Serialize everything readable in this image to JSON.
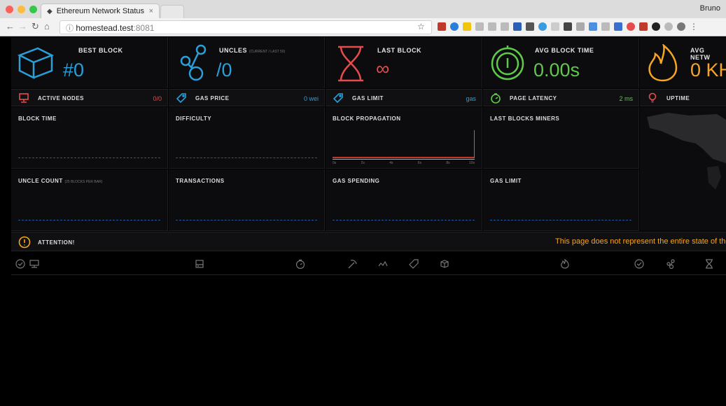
{
  "browser": {
    "tab_title": "Ethereum Network Status",
    "tab_close": "×",
    "profile": "Bruno",
    "url_host": "homestead.test",
    "url_port": ":8081",
    "traffic_colors": [
      "#fc605b",
      "#fdbc40",
      "#34c84a"
    ]
  },
  "top": {
    "best_block": {
      "label": "BEST BLOCK",
      "value": "#0",
      "color": "#2a9fd8"
    },
    "uncles": {
      "label": "UNCLES",
      "sub": "(CURRENT / LAST 50)",
      "value": "/0",
      "color": "#2a9fd8"
    },
    "last_block": {
      "label": "LAST BLOCK",
      "value": "∞",
      "color": "#e74c4c"
    },
    "avg_block_time": {
      "label": "AVG BLOCK TIME",
      "value": "0.00s",
      "color": "#5fc94b"
    },
    "avg_network": {
      "label": "AVG NETW",
      "value": "0 KH",
      "color": "#f5a623"
    }
  },
  "stats": {
    "active_nodes": {
      "label": "ACTIVE NODES",
      "value": "0/0",
      "color": "#e74c4c"
    },
    "gas_price": {
      "label": "GAS PRICE",
      "value": "0 wei",
      "color": "#2a9fd8"
    },
    "gas_limit": {
      "label": "GAS LIMIT",
      "value": "gas",
      "color": "#2a9fd8"
    },
    "page_latency": {
      "label": "PAGE LATENCY",
      "value": "2 ms",
      "color": "#5fc94b"
    },
    "uptime": {
      "label": "UPTIME",
      "color": "#e74c4c"
    }
  },
  "charts": {
    "block_time": "BLOCK TIME",
    "difficulty": "DIFFICULTY",
    "block_propagation": "BLOCK PROPAGATION",
    "last_blocks_miners": "LAST BLOCKS MINERS",
    "uncle_count": "UNCLE COUNT",
    "uncle_count_sub": "(25 BLOCKS PER BAR)",
    "transactions": "TRANSACTIONS",
    "gas_spending": "GAS SPENDING",
    "gas_limit": "GAS LIMIT",
    "propagation_ticks": [
      "0s",
      "2s",
      "4s",
      "6s",
      "8s",
      "10s"
    ]
  },
  "attention": {
    "label": "ATTENTION!",
    "message": "This page does not represent the entire state of the e"
  },
  "table_header_icons": [
    "check-circle-icon",
    "monitor-icon",
    "server-icon",
    "stopwatch-icon",
    "pickaxe-icon",
    "mountain-icon",
    "tag-icon",
    "cube-icon",
    "fire-icon",
    "check-circle-icon",
    "uncles-icon",
    "hourglass-icon"
  ]
}
